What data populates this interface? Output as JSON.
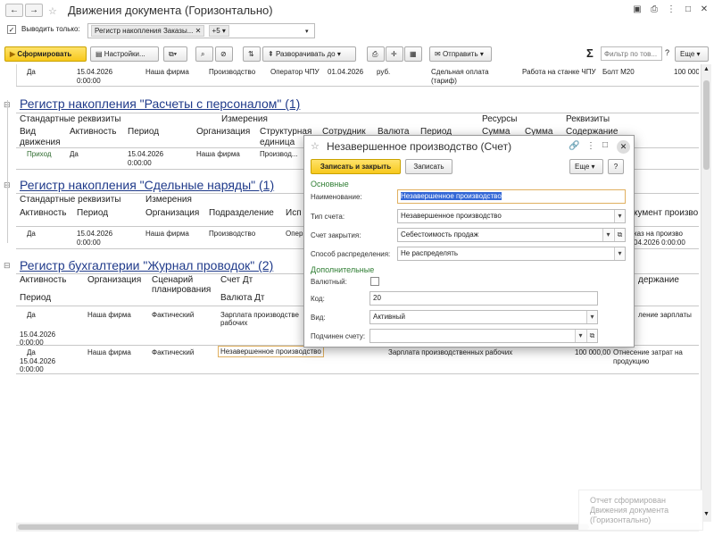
{
  "window": {
    "title": "Движения документа (Горизонтально)"
  },
  "filter": {
    "checkbox_label": "Выводить только:",
    "tag_label": "Регистр накопления Заказы...",
    "more_label": "+5"
  },
  "toolbar": {
    "generate_label": "Сформировать",
    "settings_label": "Настройки...",
    "expand_label": "Разворачивать до",
    "send_label": "Отправить",
    "sigma": "Σ",
    "filter_placeholder": "Фильтр по тов...",
    "help": "?",
    "more_label": "Еще"
  },
  "top_row": [
    "Да",
    "15.04.2026",
    "0:00:00",
    "Наша фирма",
    "Производство",
    "Оператор ЧПУ",
    "01.04.2026",
    "руб.",
    "Сдельная оплата",
    "(тариф)",
    "Работа на станке ЧПУ",
    "Болт М20",
    "100 000"
  ],
  "reg1": {
    "title": "Регистр накопления \"Расчеты с персоналом\" (1)",
    "grp_std": "Стандартные реквизиты",
    "grp_dims": "Измерения",
    "grp_res": "Ресурсы",
    "grp_req": "Реквизиты",
    "cols": [
      "Вид",
      "движения",
      "Активность",
      "Период",
      "Организация",
      "Структурная",
      "единица",
      "Сотрудник",
      "Валюта",
      "Период",
      "Сумма",
      "Сумма",
      "Содержание"
    ],
    "row": [
      "Приход",
      "Да",
      "15.04.2026",
      "0:00:00",
      "Наша фирма",
      "Производ..."
    ]
  },
  "reg2": {
    "title": "Регистр накопления \"Сдельные наряды\" (1)",
    "grp_std": "Стандартные реквизиты",
    "grp_dims": "Измерения",
    "cols": [
      "Активность",
      "Период",
      "Организация",
      "Подразделение",
      "Исп",
      "кумент произво"
    ],
    "row": [
      "Да",
      "15.04.2026",
      "0:00:00",
      "Наша фирма",
      "Производство",
      "Опер",
      "каз на произво",
      "04.2026 0:00:00"
    ]
  },
  "reg3": {
    "title": "Регистр бухгалтерии \"Журнал проводок\" (2)",
    "cols": [
      "Активность",
      "Период",
      "Организация",
      "Сценарий",
      "планирования",
      "Счет Дт",
      "Валюта Дт",
      "держание"
    ],
    "row1": [
      "Да",
      "15.04.2026",
      "0:00:00",
      "Наша фирма",
      "Фактический",
      "Зарплата производстве",
      "рабочих",
      "ление зарплаты"
    ],
    "row2": [
      "Да",
      "15.04.2026",
      "0:00:00",
      "Наша фирма",
      "Фактический",
      "Незавершенное производство",
      "Зарплата производственных рабочих",
      "100 000,00",
      "Отнесение затрат на",
      "продукцию"
    ]
  },
  "dialog": {
    "title": "Незавершенное производство (Счет)",
    "save_close_label": "Записать и закрыть",
    "save_label": "Записать",
    "more_label": "Еще",
    "help": "?",
    "sec_main": "Основные",
    "name_label": "Наименование:",
    "name_value": "Незавершенное производство",
    "type_label": "Тип счета:",
    "type_value": "Незавершенное производство",
    "close_label": "Счет закрытия:",
    "close_value": "Себестоимость продаж",
    "dist_label": "Способ распределения:",
    "dist_value": "Не распределять",
    "sec_add": "Дополнительные",
    "currency_label": "Валютный:",
    "code_label": "Код:",
    "code_value": "20",
    "kind_label": "Вид:",
    "kind_value": "Активный",
    "parent_label": "Подчинен счету:",
    "parent_value": ""
  },
  "notification": {
    "line1": "Отчет сформирован",
    "line2": "Движения документа",
    "line3": "(Горизонтально)"
  }
}
